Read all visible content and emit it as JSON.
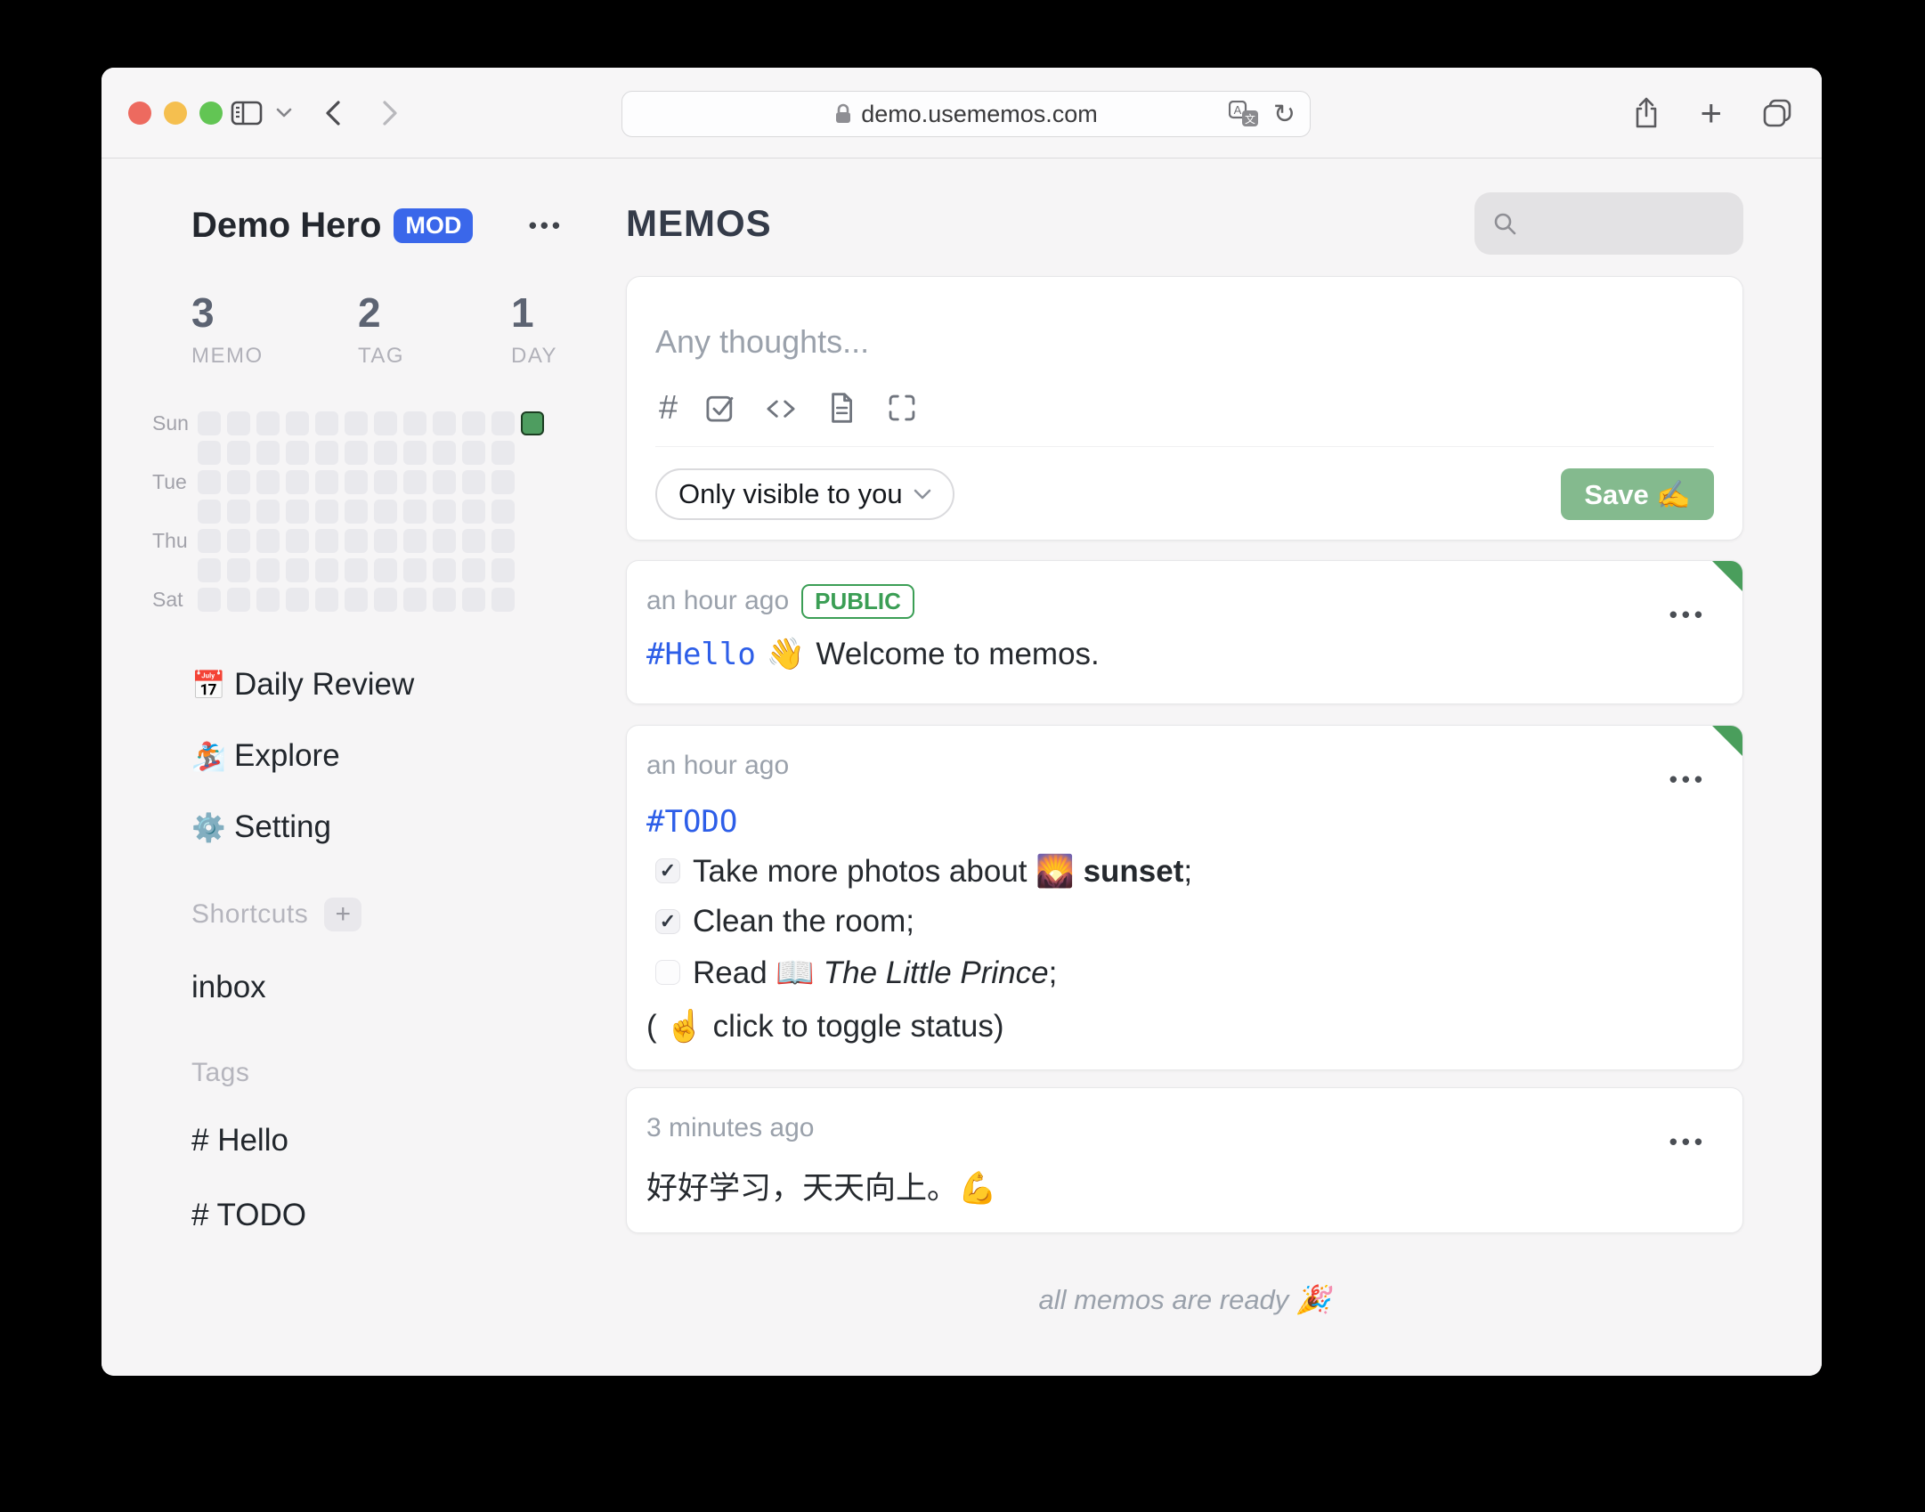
{
  "theme": {
    "traffic_red": "#ed6a5f",
    "traffic_yellow": "#f5bf4f",
    "traffic_green": "#62c554",
    "badge_blue": "#3a67ea",
    "tag_blue": "#2d5ee8",
    "public_green": "#3b9e55",
    "save_green": "#84ba8e",
    "ribbon_green": "#4a9e5c",
    "heatmap_cell": "#e9e9ed",
    "heatmap_today": "#4e9d60",
    "heatmap_today_border": "#1c3d22"
  },
  "icons": {
    "ellipsis": "•••",
    "plus": "+",
    "hash": "#",
    "check": "✓",
    "reload": "↻",
    "translate_a": "A",
    "translate_b": "文"
  },
  "browser": {
    "url": "demo.usememos.com"
  },
  "sidebar": {
    "user": {
      "name": "Demo Hero",
      "badge": "MOD"
    },
    "stats": [
      {
        "value": "3",
        "label": "MEMO"
      },
      {
        "value": "2",
        "label": "TAG"
      },
      {
        "value": "1",
        "label": "DAY"
      }
    ],
    "heatmap": {
      "rows": 7,
      "columns": 12,
      "day_labels": [
        "Sun",
        "Tue",
        "Thu",
        "Sat"
      ],
      "label_rows": [
        1,
        3,
        5,
        7
      ],
      "today": {
        "row": 1,
        "col": 12
      }
    },
    "nav": [
      {
        "icon": "📅",
        "label": "Daily Review"
      },
      {
        "icon": "🏂",
        "label": "Explore"
      },
      {
        "icon": "⚙️",
        "label": "Setting"
      }
    ],
    "shortcuts_title": "Shortcuts",
    "shortcuts": [
      "inbox"
    ],
    "tags_title": "Tags",
    "tags": [
      "# Hello",
      "# TODO"
    ]
  },
  "main": {
    "title": "MEMOS",
    "editor": {
      "placeholder": "Any thoughts...",
      "visibility": "Only visible to you",
      "save": "Save ✍️"
    },
    "memos": [
      {
        "time": "an hour ago",
        "badge": "PUBLIC",
        "parts": {
          "tag": "#Hello",
          "emoji": "👋",
          "text": "Welcome to memos."
        }
      },
      {
        "time": "an hour ago",
        "tag": "#TODO",
        "todos": [
          {
            "checked": true,
            "pre": "Take more photos about",
            "emoji": "🌄",
            "bold": "sunset",
            "post": ";"
          },
          {
            "checked": true,
            "pre": "Clean the room;"
          },
          {
            "checked": false,
            "pre": "Read",
            "emoji": "📖",
            "italic": "The Little Prince",
            "post": ";"
          }
        ],
        "note": "( ☝ click to toggle status)"
      },
      {
        "time": "3 minutes ago",
        "text": "好好学习，天天向上。💪"
      }
    ],
    "footer": "all memos are ready 🎉"
  }
}
